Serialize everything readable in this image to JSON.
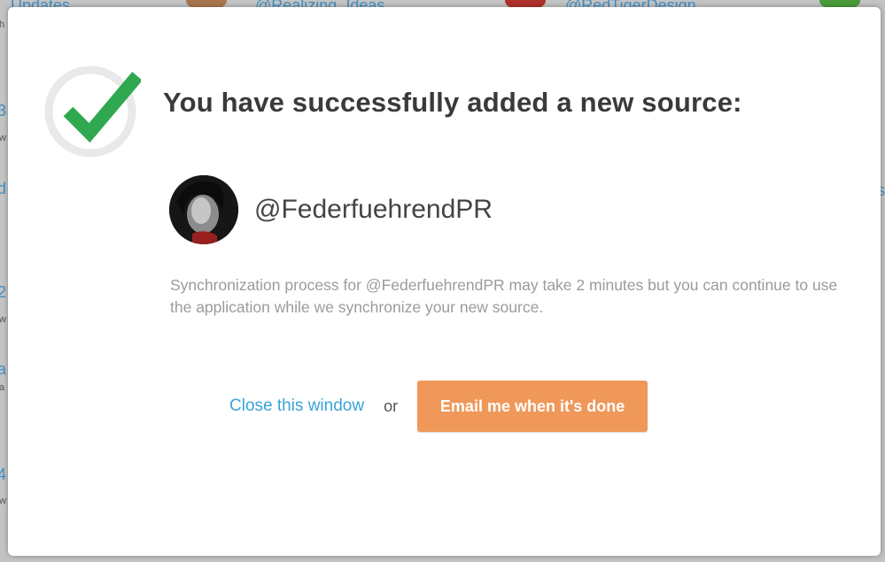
{
  "background": {
    "top_links": [
      "Updates",
      "@Realizing_Ideas",
      "@RedTigerDesign"
    ]
  },
  "modal": {
    "title": "You have successfully added a new source:",
    "success_icon": "check-mark-icon",
    "source": {
      "handle": "@FederfuehrendPR",
      "avatar": "profile-avatar"
    },
    "description": "Synchronization process for @FederfuehrendPR may take 2 minutes but you can continue to use the application while we synchronize your new source.",
    "actions": {
      "close_label": "Close this window",
      "or_label": "or",
      "email_label": "Email me when it's done"
    }
  },
  "colors": {
    "check_green": "#2fa84f",
    "badge_ring": "#e9e9e9",
    "link_blue": "#3aa3d8",
    "button_orange": "#f0985a",
    "title_text": "#3a3a3a",
    "muted_text": "#9b9b9b"
  }
}
